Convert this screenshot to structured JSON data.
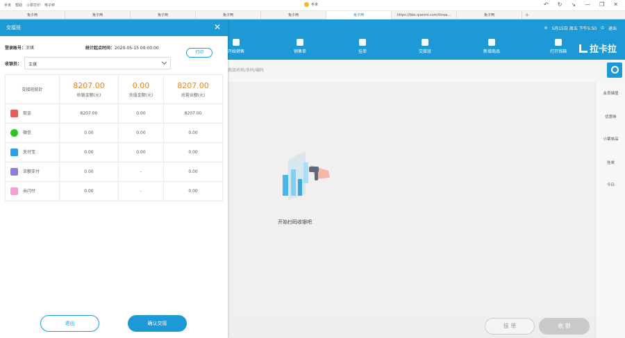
{
  "window": {
    "menu": [
      "手米",
      "帮助",
      "小票打印",
      "电子秤"
    ],
    "title": "手米",
    "controls": [
      "↶",
      "↻",
      "↘",
      "—",
      "❐",
      "✕"
    ]
  },
  "tabs": [
    {
      "label": "兔子两"
    },
    {
      "label": "兔子两"
    },
    {
      "label": "兔子两"
    },
    {
      "label": "兔子两"
    },
    {
      "label": "兔子两"
    },
    {
      "label": "兔子两",
      "active": true
    },
    {
      "label": "https://bbs.qianmi.com/threa..."
    },
    {
      "label": "兔子两"
    },
    {
      "label": "+"
    }
  ],
  "header": {
    "status": "5月15日 周五 下午5:50",
    "logout": "退出",
    "nav": [
      "开始销售",
      "销售单",
      "挂单",
      "交接班",
      "新增商品",
      "打开钱箱"
    ],
    "brand": "拉卡拉"
  },
  "search": {
    "placeholder": "商品名称/条码/编码"
  },
  "main": {
    "scan_hint": "开始扫码收银吧"
  },
  "right_side": [
    "会员储值",
    "优惠券",
    "小票单品",
    "挂单",
    "今日"
  ],
  "bottom": {
    "hang": "挂 单",
    "pay": "收 银"
  },
  "modal": {
    "title": "交接班",
    "close": "✕",
    "login_label": "登录账号：",
    "login_value": "王琪",
    "start_label": "统计起点时间：",
    "start_value": "2020-05-15 00:00:00",
    "print": "打印",
    "cashier_label": "收银员：",
    "cashier_value": "王琪",
    "table": {
      "header_label": "交接班統計",
      "totals": [
        {
          "value": "8207.00",
          "label": "收银金额(元)"
        },
        {
          "value": "0.00",
          "label": "充值金额(元)"
        },
        {
          "value": "8207.00",
          "label": "总营业额(元)"
        }
      ],
      "rows": [
        {
          "method": "现金",
          "icon_color": "#e95a5a",
          "cells": [
            "8207.00",
            "0.00",
            "8207.00"
          ]
        },
        {
          "method": "微信",
          "icon_color": "#2bc42b",
          "cells": [
            "0.00",
            "0.00",
            "0.00"
          ]
        },
        {
          "method": "支付宝",
          "icon_color": "#2a9fe3",
          "cells": [
            "0.00",
            "0.00",
            "0.00"
          ]
        },
        {
          "method": "余额支付",
          "icon_color": "#8b7fd6",
          "cells": [
            "0.00",
            "-",
            "0.00"
          ]
        },
        {
          "method": "云闪付",
          "icon_color": "#f49fd8",
          "cells": [
            "0.00",
            "-",
            "0.00"
          ]
        }
      ]
    },
    "cancel": "退出",
    "confirm": "确认交接"
  },
  "colors": {
    "accent": "#1d9ad6",
    "amount": "#f08519"
  }
}
